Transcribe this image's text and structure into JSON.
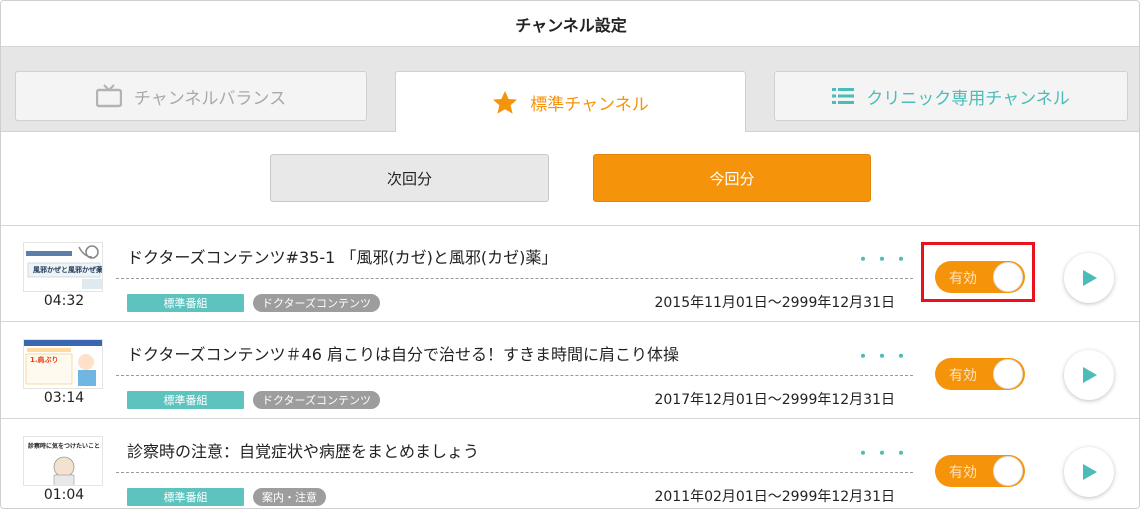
{
  "header": {
    "title": "チャンネル設定"
  },
  "tabs": [
    {
      "label": "チャンネルバランス",
      "icon": "tv-icon",
      "state": "inactive"
    },
    {
      "label": "標準チャンネル",
      "icon": "star-icon",
      "state": "active"
    },
    {
      "label": "クリニック専用チャンネル",
      "icon": "list-icon",
      "state": "inactive"
    }
  ],
  "segment": {
    "next_label": "次回分",
    "current_label": "今回分"
  },
  "colors": {
    "accent": "#f5930a",
    "teal": "#4bbcb8",
    "tag_teal": "#5ec3bf",
    "highlight": "#e8111d"
  },
  "items": [
    {
      "duration": "04:32",
      "title": "ドクターズコンテンツ#35-1 「風邪(カゼ)と風邪(カゼ)薬」",
      "more": "・・・",
      "tag_primary": "標準番組",
      "tag_secondary": "ドクターズコンテンツ",
      "date_range": "2015年11月01日～2999年12月31日",
      "toggle_label": "有効",
      "enabled": true,
      "thumb_text": "風邪かぜと風邪かぜ薬"
    },
    {
      "duration": "03:14",
      "title": "ドクターズコンテンツ＃46 肩こりは自分で治せる！すきま時間に肩こり体操",
      "more": "・・・",
      "tag_primary": "標準番組",
      "tag_secondary": "ドクターズコンテンツ",
      "date_range": "2017年12月01日～2999年12月31日",
      "toggle_label": "有効",
      "enabled": true,
      "thumb_text": "1.肩ぶり"
    },
    {
      "duration": "01:04",
      "title": "診察時の注意：自覚症状や病歴をまとめましょう",
      "more": "・・・",
      "tag_primary": "標準番組",
      "tag_secondary": "案内・注意",
      "date_range": "2011年02月01日～2999年12月31日",
      "toggle_label": "有効",
      "enabled": true,
      "thumb_text": "診察時に気をつけたいこと"
    }
  ]
}
